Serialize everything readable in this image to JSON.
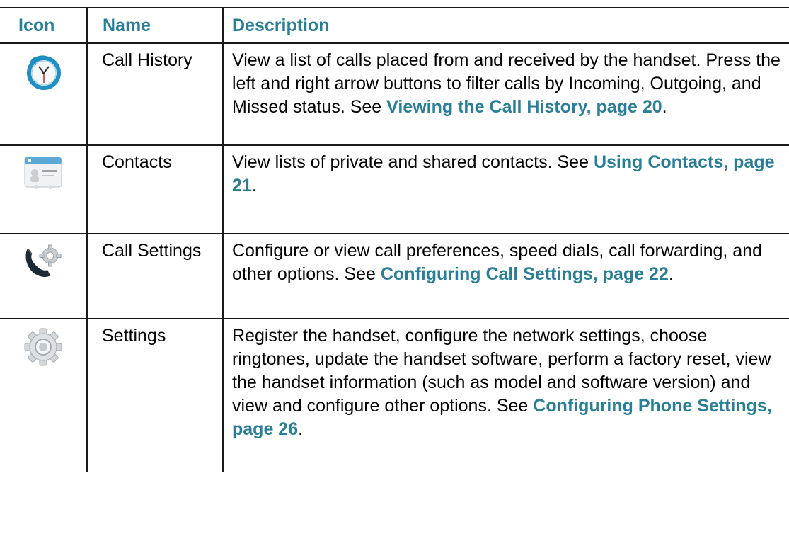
{
  "headers": {
    "icon": "Icon",
    "name": "Name",
    "description": "Description"
  },
  "rows": [
    {
      "icon": "call-history-clock-icon",
      "name": "Call History",
      "description": "View a list of calls placed from and received by the handset. Press the left and right arrow buttons to filter calls by Incoming, Outgoing, and Missed status. See ",
      "link": "Viewing the Call History, page 20",
      "end": "."
    },
    {
      "icon": "contacts-card-icon",
      "name": "Contacts",
      "description": "View lists of private and shared contacts. See ",
      "link": "Using Contacts, page 21",
      "end": "."
    },
    {
      "icon": "call-settings-handset-gear-icon",
      "name": "Call Settings",
      "description": "Configure or view call preferences, speed dials, call forwarding, and other options. See ",
      "link": "Configuring Call Settings, page 22",
      "end": "."
    },
    {
      "icon": "settings-gear-icon",
      "name": "Settings",
      "description": "Register the handset, configure the network settings, choose ringtones, update the handset software, perform a factory reset, view the handset information (such as model and software version) and view and configure other options. See ",
      "link": "Configuring Phone Settings, page 26",
      "end": "."
    }
  ]
}
